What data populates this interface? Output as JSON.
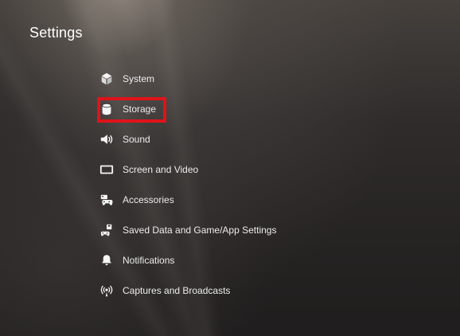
{
  "header": {
    "title": "Settings"
  },
  "menu": {
    "items": [
      {
        "label": "System",
        "icon": "cube-icon"
      },
      {
        "label": "Storage",
        "icon": "storage-cylinder-icon"
      },
      {
        "label": "Sound",
        "icon": "speaker-icon"
      },
      {
        "label": "Screen and Video",
        "icon": "screen-icon"
      },
      {
        "label": "Accessories",
        "icon": "controller-icon"
      },
      {
        "label": "Saved Data and Game/App Settings",
        "icon": "saved-data-controller-icon"
      },
      {
        "label": "Notifications",
        "icon": "bell-icon"
      },
      {
        "label": "Captures and Broadcasts",
        "icon": "broadcast-icon"
      }
    ],
    "highlighted_index": 1
  },
  "colors": {
    "highlight": "#e0131a",
    "text": "#ececec"
  }
}
